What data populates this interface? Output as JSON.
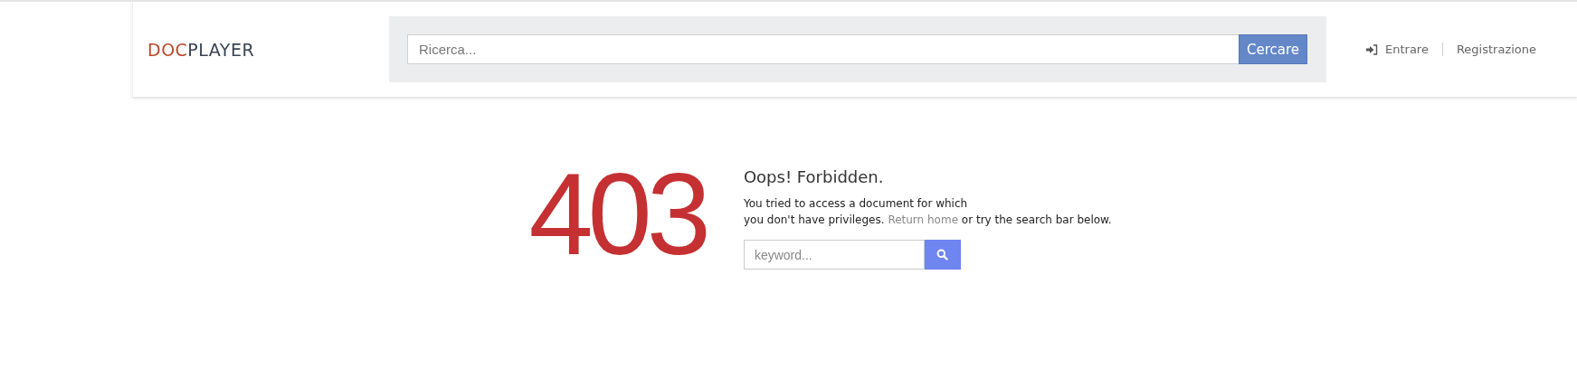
{
  "header": {
    "logo": {
      "part_1": "DOC",
      "part_2": "PLAYER"
    },
    "search": {
      "placeholder": "Ricerca...",
      "button": "Cercare"
    },
    "nav": [
      {
        "kind": "login",
        "label": "Entrare"
      },
      {
        "kind": "plain",
        "label": "Registrazione"
      }
    ]
  },
  "error": {
    "code": "403",
    "title": "Oops! Forbidden.",
    "message_line_1": "You tried to access a document for which",
    "message_before_link": "you don't have privileges.",
    "link": "Return home",
    "message_after_link": "or try the search bar below.",
    "search": {
      "placeholder": "keyword..."
    }
  }
}
